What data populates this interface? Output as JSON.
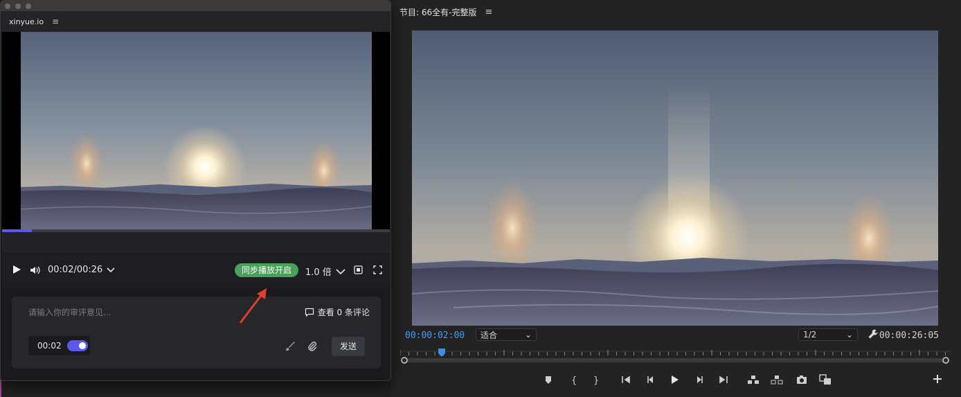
{
  "app_window": {
    "panel_title": "xinyue.io",
    "time_display": "00:02/00:26",
    "progress": 0.077,
    "sync_badge": "同步播放开启",
    "speed": "1.0 倍",
    "comment_placeholder": "请输入你的审评意见...",
    "view_comments": "查看 0 条评论",
    "time_chip": "00:02",
    "toggle_on": true,
    "send_label": "发送"
  },
  "program_panel": {
    "title": "节目: 66全有-完整版",
    "current_timecode": "00:00:02:00",
    "duration_timecode": "00:00:26:05",
    "fit_label": "适合",
    "resolution_label": "1/2"
  },
  "colors": {
    "accent_blue": "#3aa0ff",
    "toggle_purple": "#5b58f0",
    "sync_green": "#49a05a",
    "annotation_red": "#e0402c"
  }
}
